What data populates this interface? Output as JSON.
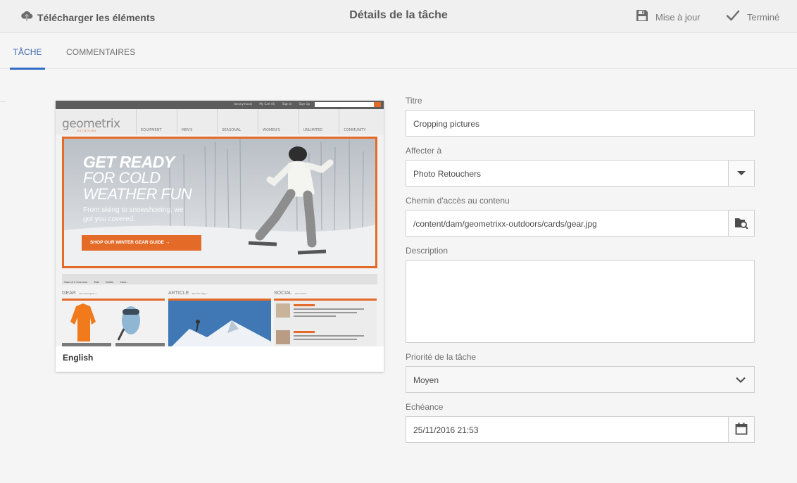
{
  "topbar": {
    "download_label": "Télécharger les éléments",
    "title": "Détails de la tâche",
    "save_label": "Mise à jour",
    "done_label": "Terminé"
  },
  "tabs": [
    {
      "label": "Tâche",
      "active": true
    },
    {
      "label": "Commentaires",
      "active": false
    }
  ],
  "card": {
    "caption": "English",
    "thumbnail": {
      "top_links": [
        "(anonymous)",
        "My Cart (0)",
        "Sign In",
        "Sign Up"
      ],
      "logo": "geometrix",
      "logo_sub": "OUTDOORS",
      "nav": [
        "EQUIPMENT",
        "MEN'S",
        "SEASONAL",
        "WOMEN'S",
        "UNLIMITED",
        "COMMUNITY"
      ],
      "hero_line1": "GET READY",
      "hero_line2": "FOR COLD",
      "hero_line3": "WEATHER FUN",
      "hero_sub": "From skiing to snowshoeing, we got you covered.",
      "hero_cta": "SHOP OUR WINTER GEAR GUIDE →",
      "toolbar": [
        "Start of 3 Columns",
        "Edit",
        "Delete",
        "New..."
      ],
      "columns": [
        {
          "title": "GEAR",
          "link": "see more gear »"
        },
        {
          "title": "ARTICLE",
          "link": "see the blog »"
        },
        {
          "title": "SOCIAL",
          "link": "see more »"
        }
      ]
    }
  },
  "form": {
    "title_label": "Titre",
    "title_value": "Cropping pictures",
    "assign_label": "Affecter à",
    "assign_value": "Photo Retouchers",
    "path_label": "Chemin d'accès au contenu",
    "path_value": "/content/dam/geometrixx-outdoors/cards/gear.jpg",
    "description_label": "Description",
    "description_value": "",
    "priority_label": "Priorité de la tâche",
    "priority_value": "Moyen",
    "due_label": "Echéance",
    "due_value": "25/11/2016 21:53"
  },
  "icons": {
    "download": "upload-cloud-icon",
    "save": "floppy-disk-icon",
    "done": "checkmark-icon",
    "dropdown": "caret-down-icon",
    "browse": "folder-search-icon",
    "select": "chevron-down-icon",
    "calendar": "calendar-icon"
  },
  "colors": {
    "accent": "#326ec8",
    "brand_orange": "#e46a27"
  }
}
